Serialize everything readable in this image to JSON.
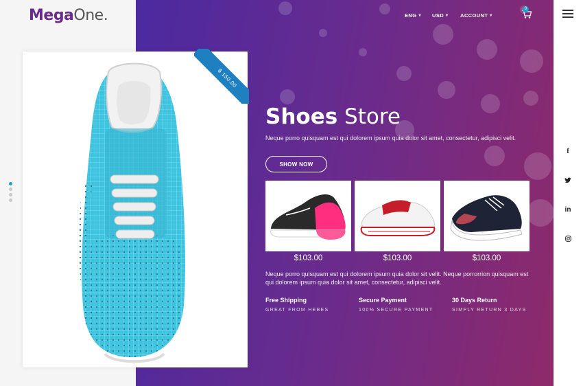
{
  "brand": {
    "part1": "Mega",
    "part2": "One."
  },
  "nav": {
    "language": "ENG",
    "currency": "USD",
    "account": "ACCOUNT",
    "cart_count": "0"
  },
  "hero": {
    "title_bold": "Shoes",
    "title_light": "Store",
    "description": "Neque porro quisquam est qui dolorem ipsum quia dolor sit amet, consectetur, adipisci velit.",
    "cta_label": "SHOW NOW"
  },
  "featured_product": {
    "price_tag": "$ 150.00"
  },
  "products": [
    {
      "price": "$103.00"
    },
    {
      "price": "$103.00"
    },
    {
      "price": "$103.00"
    }
  ],
  "description2": "Neque porro quisquam est qui dolorem ipsum quia dolor sit velit. Neque porrorrion quisquam est qui dolorem ipsum quia dolor sit amet, consectetur, adipisci velit.",
  "features": [
    {
      "title": "Free Shipping",
      "subtitle": "GREAT FROM HEBES"
    },
    {
      "title": "Secure Payment",
      "subtitle": "100% SECURE PAYMENT"
    },
    {
      "title": "30 Days Return",
      "subtitle": "SIMPLY RETURN 3 DAYS"
    }
  ],
  "social": [
    "f",
    "twitter-icon",
    "in",
    "instagram-icon"
  ],
  "colors": {
    "accent": "#21a0c8",
    "brand": "#6a2b8c",
    "ribbon": "#1e7fc1"
  }
}
